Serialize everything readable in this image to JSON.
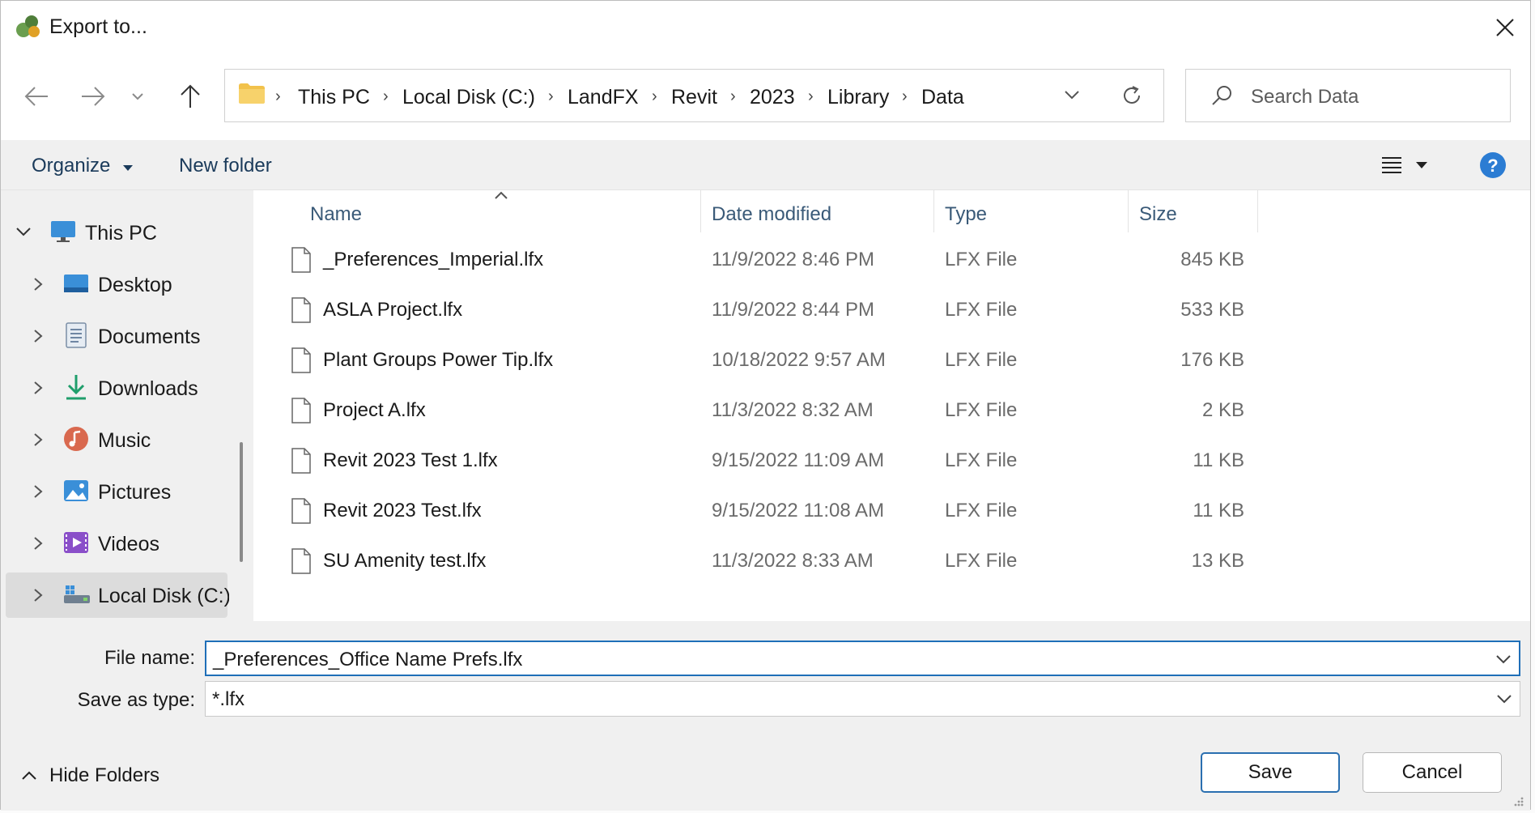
{
  "dialog": {
    "title": "Export to..."
  },
  "address": {
    "crumbs": [
      "This PC",
      "Local Disk (C:)",
      "LandFX",
      "Revit",
      "2023",
      "Library",
      "Data"
    ]
  },
  "search": {
    "placeholder": "Search Data"
  },
  "toolbar": {
    "organize": "Organize",
    "new_folder": "New folder"
  },
  "sidebar": {
    "items": [
      {
        "label": "This PC",
        "icon": "monitor-icon"
      },
      {
        "label": "Desktop",
        "icon": "desktop-icon"
      },
      {
        "label": "Documents",
        "icon": "documents-icon"
      },
      {
        "label": "Downloads",
        "icon": "download-icon"
      },
      {
        "label": "Music",
        "icon": "music-icon"
      },
      {
        "label": "Pictures",
        "icon": "pictures-icon"
      },
      {
        "label": "Videos",
        "icon": "videos-icon"
      },
      {
        "label": "Local Disk (C:)",
        "icon": "drive-icon"
      }
    ]
  },
  "files": {
    "columns": {
      "name": "Name",
      "date": "Date modified",
      "type": "Type",
      "size": "Size"
    },
    "rows": [
      {
        "name": "_Preferences_Imperial.lfx",
        "date": "11/9/2022 8:46 PM",
        "type": "LFX File",
        "size": "845 KB"
      },
      {
        "name": "ASLA Project.lfx",
        "date": "11/9/2022 8:44 PM",
        "type": "LFX File",
        "size": "533 KB"
      },
      {
        "name": "Plant Groups Power Tip.lfx",
        "date": "10/18/2022 9:57 AM",
        "type": "LFX File",
        "size": "176 KB"
      },
      {
        "name": "Project A.lfx",
        "date": "11/3/2022 8:32 AM",
        "type": "LFX File",
        "size": "2 KB"
      },
      {
        "name": "Revit 2023 Test 1.lfx",
        "date": "9/15/2022 11:09 AM",
        "type": "LFX File",
        "size": "11 KB"
      },
      {
        "name": "Revit 2023 Test.lfx",
        "date": "9/15/2022 11:08 AM",
        "type": "LFX File",
        "size": "11 KB"
      },
      {
        "name": "SU Amenity test.lfx",
        "date": "11/3/2022 8:33 AM",
        "type": "LFX File",
        "size": "13 KB"
      }
    ]
  },
  "form": {
    "file_name_label": "File name:",
    "file_name_value": "_Preferences_Office Name Prefs.lfx",
    "save_type_label": "Save as type:",
    "save_type_value": "*.lfx"
  },
  "footer": {
    "hide_folders": "Hide Folders",
    "save": "Save",
    "cancel": "Cancel"
  },
  "colors": {
    "accent": "#1f6fb8",
    "help": "#2b7cd3",
    "folder": "#f2c24b"
  }
}
